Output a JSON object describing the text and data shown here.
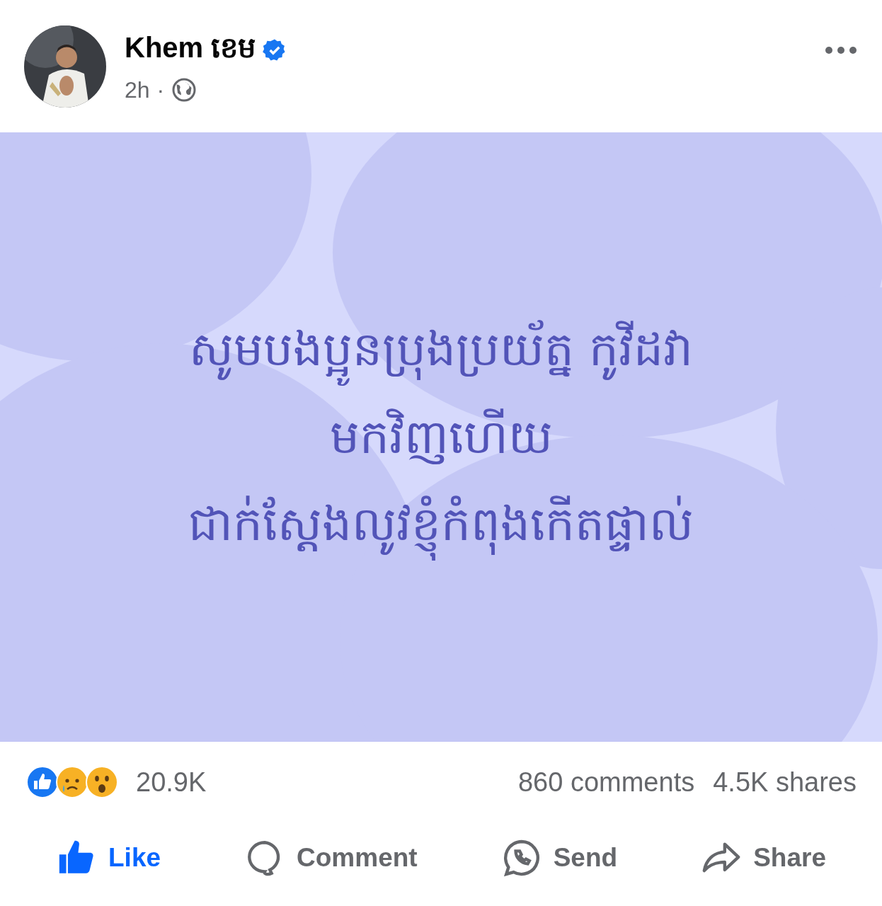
{
  "post": {
    "author": "Khem ខេម",
    "verified": true,
    "time": "2h",
    "separator": "·"
  },
  "text_lines": [
    "សូមបងប្អូនប្រុងប្រយ័ត្ន កូវីដវា",
    "មកវិញហើយ",
    "ជាក់ស្តែងលូវខ្ញុំកំពុងកើតផ្ទាល់"
  ],
  "stats": {
    "reactions_count": "20.9K",
    "comments": "860 comments",
    "shares": "4.5K shares"
  },
  "actions": [
    {
      "kind": "like",
      "label": "Like",
      "selected": true
    },
    {
      "kind": "comment",
      "label": "Comment",
      "selected": false
    },
    {
      "kind": "send",
      "label": "Send",
      "selected": false
    },
    {
      "kind": "share",
      "label": "Share",
      "selected": false
    }
  ]
}
